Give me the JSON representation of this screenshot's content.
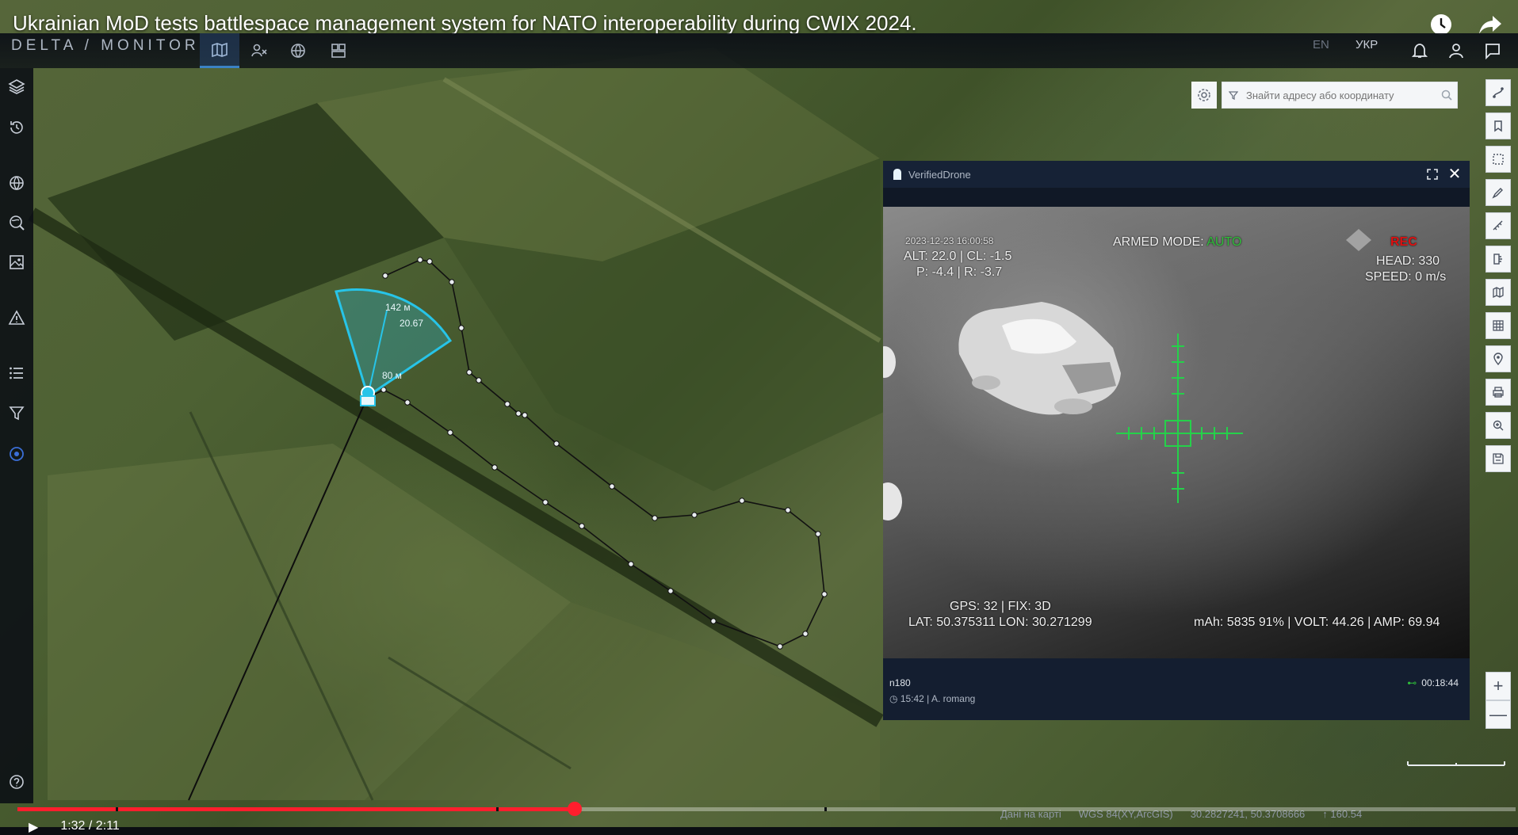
{
  "video": {
    "title": "Ukrainian MoD tests battlespace management system for NATO interoperability during CWIX 2024.",
    "icons": [
      "clock-icon",
      "share-icon"
    ]
  },
  "app": {
    "logo": "DELTA / MONITOR",
    "nav": [
      {
        "name": "map-icon",
        "active": true
      },
      {
        "name": "users-map-icon",
        "active": false
      },
      {
        "name": "globe-icon",
        "active": false
      },
      {
        "name": "grid-icon",
        "active": false
      }
    ],
    "lang_en": "EN",
    "lang_ua": "УКР",
    "top_right_icons": [
      "bell-icon",
      "user-icon",
      "message-icon"
    ]
  },
  "sidebar": {
    "items": [
      "layers-icon",
      "history-icon",
      "globe-icon",
      "world-search-icon",
      "image-icon",
      "warning-icon",
      "list-icon",
      "filter-icon",
      "target-icon"
    ],
    "help": "help-icon"
  },
  "search": {
    "placeholder": "Знайти адресу або координату"
  },
  "right_toolbar": {
    "items": [
      "route-icon",
      "bookmark-icon",
      "select-area-icon",
      "draw-icon",
      "measure-icon",
      "ruler-icon",
      "map-layers-icon",
      "grid-icon",
      "pin-icon",
      "print-icon",
      "zoom-area-icon",
      "save-icon"
    ],
    "zoom_in": "+",
    "zoom_out": "—"
  },
  "map": {
    "sector_labels": [
      "142 м",
      "20.67",
      "80 м"
    ],
    "accent": "#27c4e8"
  },
  "drone_panel": {
    "title": "VerifiedDrone",
    "osd": {
      "timestamp": "2023-12-23 16:00:58",
      "line1": "ALT: 22.0 | CL: -1.5",
      "line2": "P: -4.4 | R: -3.7",
      "armed_label": "ARMED MODE:",
      "armed_mode": "AUTO",
      "rec": "REC",
      "head": "HEAD: 330",
      "speed": "SPEED:  0 m/s",
      "gps": "GPS: 32 | FIX: 3D",
      "latlon": "LAT: 50.375311 LON: 30.271299",
      "battery": "mAh: 5835 91% | VOLT: 44.26 | AMP: 69.94"
    },
    "footer": {
      "id": "n180",
      "meta": "15:42 | A. romang",
      "duration": "00:18:44"
    }
  },
  "status_bar": {
    "layer": "Дані на карті",
    "crs": "WGS 84(XY,ArcGIS)",
    "coords": "30.2827241, 50.3708666",
    "elevation": "↑ 160.54"
  },
  "player": {
    "progress": 0.372,
    "time": "1:32 / 2:11"
  }
}
